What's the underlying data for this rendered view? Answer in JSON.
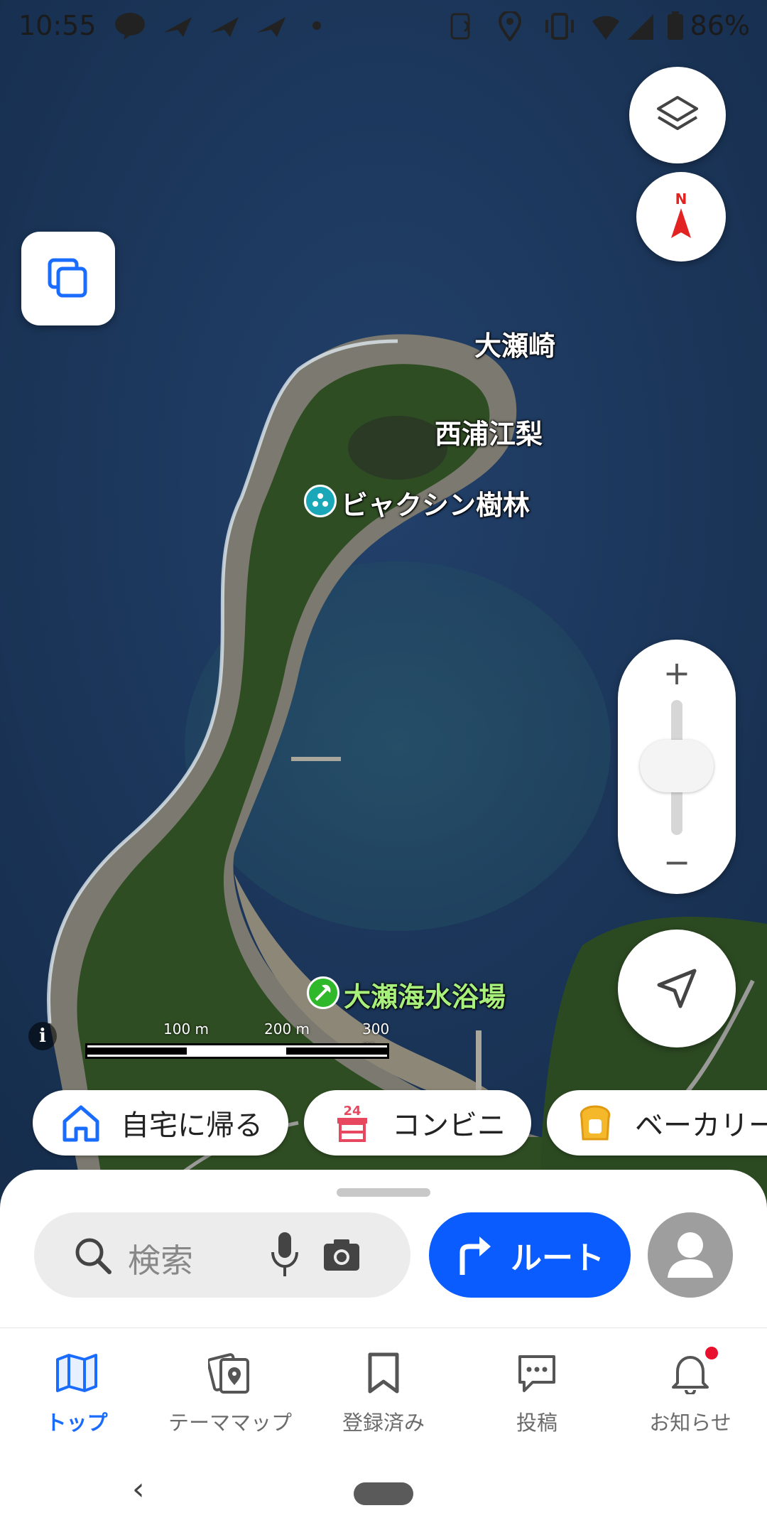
{
  "status_bar": {
    "time": "10:55",
    "battery": "86%",
    "icons": [
      "line-icon",
      "paper-plane-icon",
      "paper-plane-icon",
      "paper-plane-icon",
      "dot-icon",
      "nfc-icon",
      "location-icon",
      "vibrate-icon",
      "wifi-icon",
      "signal-icon",
      "battery-icon"
    ]
  },
  "map": {
    "labels": {
      "cape": "大瀬崎",
      "pond": "西浦江梨",
      "poi_forest": "ビャクシン樹林",
      "poi_beach": "大瀬海水浴場"
    },
    "scale": {
      "tick1": "100 m",
      "tick2": "200 m",
      "tick3": "300 m"
    },
    "info": "i",
    "zoom_in": "+",
    "zoom_out": "−",
    "compass_letter": "N",
    "colors": {
      "sea": "#1d3a5e",
      "land": "#2e4a22",
      "beach": "#8a8477",
      "poi_teal": "#1aa7b8",
      "poi_green": "#2fb82a"
    }
  },
  "chips": [
    {
      "label": "自宅に帰る",
      "icon": "home-icon"
    },
    {
      "label": "コンビニ",
      "icon": "convenience-store-icon",
      "icon_text": "24"
    },
    {
      "label": "ベーカリー",
      "icon": "bread-icon"
    }
  ],
  "sheet": {
    "search_placeholder": "検索",
    "route_label": "ルート",
    "accent": "#0a5cff"
  },
  "bottom_nav": [
    {
      "label": "トップ",
      "icon": "map-icon",
      "active": true
    },
    {
      "label": "テーママップ",
      "icon": "theme-map-icon",
      "active": false
    },
    {
      "label": "登録済み",
      "icon": "bookmark-icon",
      "active": false
    },
    {
      "label": "投稿",
      "icon": "chat-icon",
      "active": false
    },
    {
      "label": "お知らせ",
      "icon": "bell-icon",
      "active": false,
      "badge": true
    }
  ],
  "system_nav": {
    "back": "‹"
  }
}
